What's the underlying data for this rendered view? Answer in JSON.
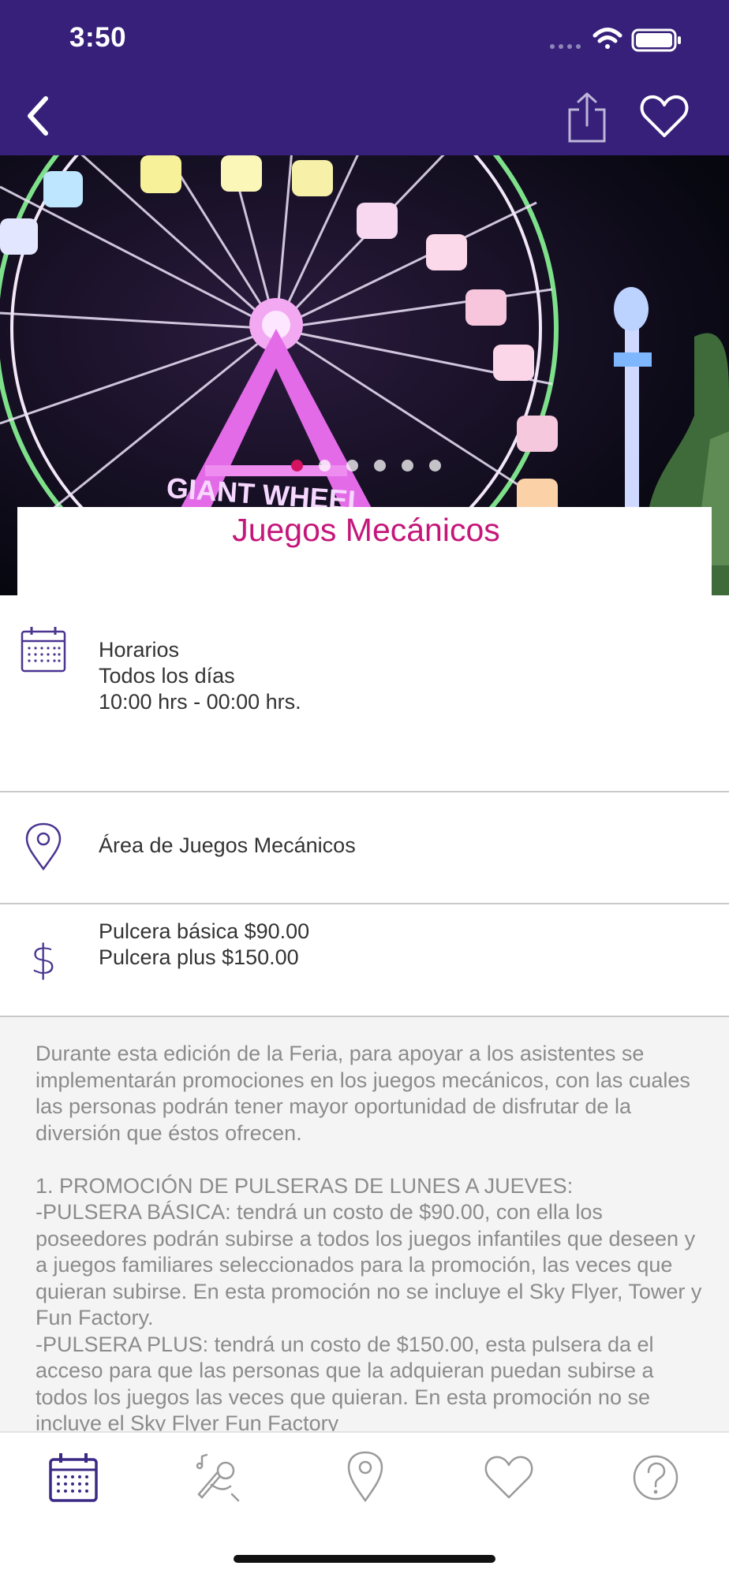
{
  "status_bar": {
    "time": "3:50"
  },
  "nav": {
    "back_icon": "chevron-left-icon",
    "share_icon": "share-icon",
    "favorite_icon": "heart-icon"
  },
  "hero": {
    "image": "ferris-wheel-photo",
    "slides": 6,
    "active_slide": 1
  },
  "title": "Juegos Mecánicos",
  "schedule": {
    "heading": "Horarios",
    "days": "Todos los días",
    "hours": "10:00 hrs - 00:00 hrs."
  },
  "location": {
    "text": "Área de Juegos Mecánicos"
  },
  "prices": {
    "basic": "Pulcera básica $90.00",
    "plus": "Pulcera plus $150.00"
  },
  "description": "Durante esta edición de la Feria, para apoyar a los asistentes se implementarán promociones en los juegos mecánicos, con las cuales las personas podrán tener mayor oportunidad de disfrutar de la diversión que éstos ofrecen.\n\n1. PROMOCIÓN DE PULSERAS DE LUNES A JUEVES:\n-PULSERA BÁSICA: tendrá un costo de $90.00, con ella los poseedores podrán subirse a todos los juegos infantiles que deseen  y a juegos familiares seleccionados para la promoción, las veces que quieran subirse. En esta promoción no se incluye el Sky Flyer, Tower y Fun Factory.\n-PULSERA PLUS: tendrá un costo de $150.00, esta pulsera da el acceso para que las personas que la adquieran puedan subirse a todos los juegos las veces que quieran. En esta promoción no se incluye el Sky Flyer Fun Factory",
  "tabbar": {
    "items": [
      "calendar-icon",
      "singer-microphone-icon",
      "location-pin-icon",
      "heart-icon",
      "help-icon"
    ],
    "active": 0
  },
  "colors": {
    "nav": "#37207a",
    "accent": "#c5177a",
    "icon": "#4a3590",
    "active_dot": "#d3135f"
  }
}
